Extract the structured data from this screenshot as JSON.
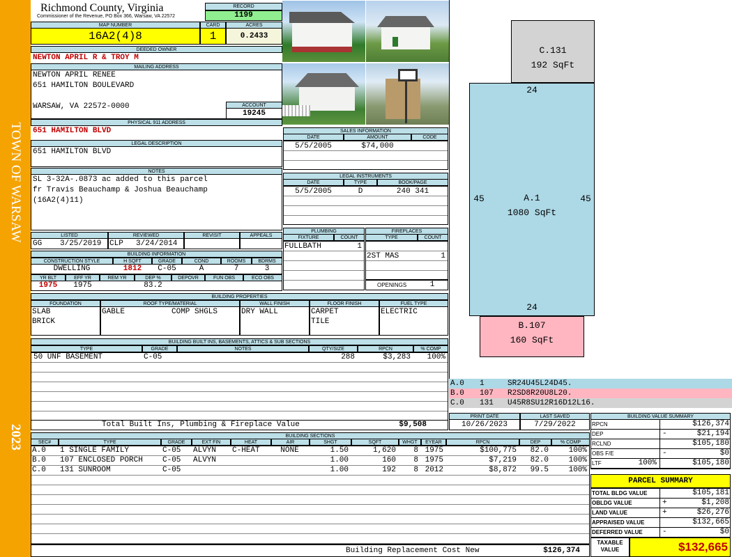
{
  "side": {
    "town": "TOWN OF WARSAW",
    "year": "2023"
  },
  "head": {
    "county": "Richmond County, Virginia",
    "commissioner": "Commissioner of the Revenue, PO Box 366, Warsaw, VA 22572",
    "record_label": "RECORD",
    "record": "1199",
    "map_label": "MAP NUMBER",
    "map": "16A2(4)8",
    "card_label": "CARD",
    "card": "1",
    "acres_label": "ACRES",
    "acres": "0.2433"
  },
  "owner": {
    "deeded_label": "DEEDED OWNER",
    "deeded": "NEWTON APRIL R & TROY M",
    "mailing_label": "MAILING ADDRESS",
    "mail1": "NEWTON APRIL RENEE",
    "mail2": "651 HAMILTON BOULEVARD",
    "mail3": "WARSAW, VA 22572-0000",
    "account_label": "ACCOUNT",
    "account": "19245",
    "phys_label": "PHYSICAL 911 ADDRESS",
    "physical": "651 HAMILTON BLVD",
    "legal_label": "LEGAL DESCRIPTION",
    "legal": "651 HAMILTON BLVD",
    "notes_label": "NOTES",
    "note1": "SL 3-32A-.0873 ac added to this parcel",
    "note2": "fr Travis Beauchamp & Joshua Beauchamp",
    "note3": "(16A2(4)11)"
  },
  "review": {
    "listed_label": "LISTED",
    "reviewed_label": "REVIEWED",
    "revisit_label": "REVISIT",
    "appeals_label": "APPEALS",
    "listed_by": "GG",
    "listed_date": "3/25/2019",
    "reviewed_by": "CLP",
    "reviewed_date": "3/24/2014"
  },
  "bldg": {
    "info_label": "BUILDING INFORMATION",
    "h_cstyle": "CONSTRUCTION STYLE",
    "h_hsqft": "H SQFT",
    "h_grade": "GRADE",
    "h_cond": "COND",
    "h_rooms": "ROOMS",
    "h_bdrms": "BDRMS",
    "cstyle": "DWELLING",
    "hsqft": "1812",
    "grade": "C-05",
    "cond": "A",
    "rooms": "7",
    "bdrms": "3",
    "h_yrblt": "YR BLT",
    "h_effyr": "EFF YR",
    "h_remyr": "REM YR",
    "h_dep": "DEP %",
    "h_depovr": "DEPOVR",
    "h_funobs": "FUN OBS",
    "h_ecoobs": "ECO OBS",
    "yrblt": "1975",
    "effyr": "1975",
    "dep": "83.2"
  },
  "sales": {
    "label": "SALES INFORMATION",
    "h_date": "DATE",
    "h_amount": "AMOUNT",
    "h_code": "CODE",
    "date": "5/5/2005",
    "amount": "$74,000"
  },
  "legal_instr": {
    "label": "LEGAL INSTRUMENTS",
    "h_date": "DATE",
    "h_type": "TYPE",
    "h_book": "BOOK/PAGE",
    "date": "5/5/2005",
    "type": "D",
    "book": "240 341"
  },
  "plumbing": {
    "label": "PLUMBING",
    "h_fixture": "FIXTURE",
    "h_count": "COUNT",
    "fixture": "FULLBATH",
    "count": "1"
  },
  "fireplaces": {
    "label": "FIREPLACES",
    "h_type": "TYPE",
    "h_count": "COUNT",
    "type": "2ST MAS",
    "count": "1",
    "openings_label": "OPENINGS",
    "openings": "1"
  },
  "props": {
    "label": "BUILDING PROPERTIES",
    "h_found": "FOUNDATION",
    "h_roof": "ROOF TYPE/MATERIAL",
    "h_wall": "WALL FINISH",
    "h_floor": "FLOOR FINISH",
    "h_fuel": "FUEL TYPE",
    "found1": "SLAB",
    "found2": "BRICK",
    "roof1": "GABLE",
    "roof2": "COMP SHGLS",
    "wall": "DRY WALL",
    "floor1": "CARPET",
    "floor2": "TILE",
    "fuel": "ELECTRIC"
  },
  "builtins": {
    "label": "BUILDING BUILT INS, BASEMENTS, ATTICS & SUB SECTIONS",
    "h_type": "TYPE",
    "h_grade": "GRADE",
    "h_notes": "NOTES",
    "h_qty": "QTY/SIZE",
    "h_rpcn": "RPCN",
    "h_comp": "% COMP",
    "type": "50 UNF BASEMENT",
    "grade": "C-05",
    "qty": "288",
    "rpcn": "$3,283",
    "comp": "100%",
    "total_label": "Total Built Ins, Plumbing & Fireplace Value",
    "total": "$9,508"
  },
  "sketch": {
    "c_label": "C.131",
    "c_area": "192 SqFt",
    "a_label": "A.1",
    "a_area": "1080 SqFt",
    "b_label": "B.107",
    "b_area": "160 SqFt",
    "dim_top": "24",
    "dim_bottom": "24",
    "dim_left": "45",
    "dim_right": "45",
    "legend": [
      {
        "id": "A.0",
        "code": "1",
        "path": "SR24U45L24D45."
      },
      {
        "id": "B.0",
        "code": "107",
        "path": "R2SD8R20U8L20."
      },
      {
        "id": "C.0",
        "code": "131",
        "path": "U45R8SU12R16D12L16."
      }
    ],
    "colors": {
      "a": "#add8e6",
      "b": "#ffb6c1",
      "c": "#d3d3d3"
    }
  },
  "dates": {
    "print_label": "PRINT DATE",
    "print": "10/26/2023",
    "saved_label": "LAST SAVED",
    "saved": "7/29/2022"
  },
  "sections": {
    "label": "BUILDING SECTIONS",
    "headers": [
      "SEC#",
      "TYPE",
      "GRADE",
      "EXT FIN",
      "HEAT",
      "AIR",
      "SHGT",
      "SQFT",
      "WHGT",
      "EYEAR",
      "RPCN",
      "DEP",
      "% COMP"
    ],
    "rows": [
      [
        "A.0",
        "1 SINGLE FAMILY",
        "C-05",
        "ALVYN",
        "C-HEAT",
        "NONE",
        "1.50",
        "1,620",
        "8",
        "1975",
        "$100,775",
        "82.0",
        "100%"
      ],
      [
        "B.0",
        "107 ENCLOSED PORCH",
        "C-05",
        "ALVYN",
        "",
        "",
        "1.00",
        "160",
        "8",
        "1975",
        "$7,219",
        "82.0",
        "100%"
      ],
      [
        "C.0",
        "131 SUNROOM",
        "C-05",
        "",
        "",
        "",
        "1.00",
        "192",
        "8",
        "2012",
        "$8,872",
        "99.5",
        "100%"
      ]
    ],
    "replacement_label": "Building Replacement Cost New",
    "replacement": "$126,374"
  },
  "bvs": {
    "label": "BUILDING VALUE SUMMARY",
    "rpcn_label": "RPCN",
    "rpcn": "$126,374",
    "dep_label": "DEP",
    "dep_sign": "-",
    "dep": "$21,194",
    "rclnd_label": "RCLND",
    "rclnd": "$105,180",
    "obs_label": "OBS F/E",
    "obs_sign": "-",
    "obs": "$0",
    "ltf_label": "LTF",
    "ltf_pct": "100%",
    "ltf": "$105,180"
  },
  "ps": {
    "label": "PARCEL SUMMARY",
    "tbv_label": "TOTAL BLDG VALUE",
    "tbv": "$105,181",
    "obldg_label": "OBLDG VALUE",
    "obldg_sign": "+",
    "obldg": "$1,208",
    "land_label": "LAND VALUE",
    "land_sign": "+",
    "land": "$26,276",
    "appr_label": "APPRAISED VALUE",
    "appr": "$132,665",
    "def_label": "DEFERRED VALUE",
    "def_sign": "-",
    "def": "$0",
    "tax_label1": "TAXABLE",
    "tax_label2": "VALUE",
    "tax": "$132,665"
  }
}
